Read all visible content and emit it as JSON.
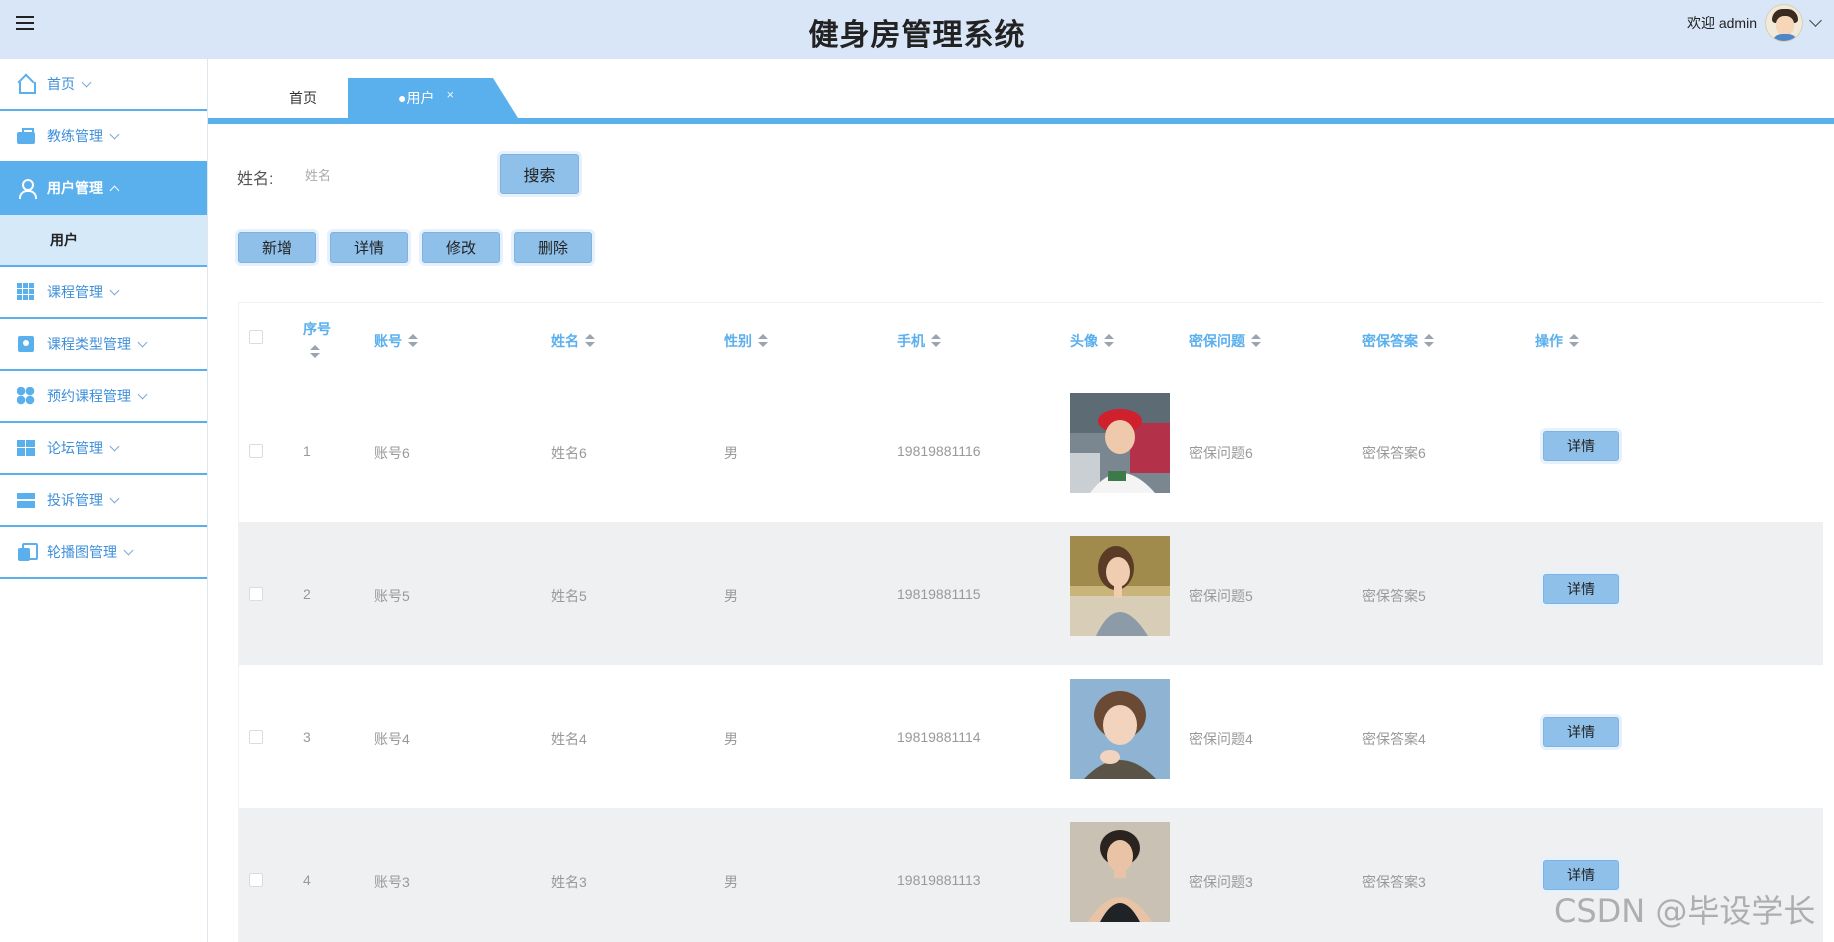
{
  "header": {
    "title": "健身房管理系统",
    "welcome": "欢迎 admin"
  },
  "sidebar": {
    "items": [
      {
        "label": "首页",
        "icon": "home-icon"
      },
      {
        "label": "教练管理",
        "icon": "briefcase-icon"
      },
      {
        "label": "用户管理",
        "icon": "user-icon",
        "active": true
      },
      {
        "label": "课程管理",
        "icon": "grid-icon"
      },
      {
        "label": "课程类型管理",
        "icon": "card-icon"
      },
      {
        "label": "预约课程管理",
        "icon": "clover-icon"
      },
      {
        "label": "论坛管理",
        "icon": "windows-icon"
      },
      {
        "label": "投诉管理",
        "icon": "tray-icon"
      },
      {
        "label": "轮播图管理",
        "icon": "copy-icon"
      }
    ],
    "submenu": {
      "label": "用户"
    }
  },
  "tabs": {
    "home": "首页",
    "user": "●用户",
    "close": "×"
  },
  "search": {
    "label": "姓名:",
    "placeholder": "姓名",
    "value": "",
    "button": "搜索"
  },
  "actions": {
    "add": "新增",
    "detail": "详情",
    "edit": "修改",
    "delete": "删除"
  },
  "table": {
    "headers": {
      "seq": "序号",
      "account": "账号",
      "name": "姓名",
      "gender": "性别",
      "phone": "手机",
      "avatar": "头像",
      "question": "密保问题",
      "answer": "密保答案",
      "op": "操作"
    },
    "rows": [
      {
        "seq": "1",
        "account": "账号6",
        "name": "姓名6",
        "gender": "男",
        "phone": "19819881116",
        "question": "密保问题6",
        "answer": "密保答案6",
        "op": "详情"
      },
      {
        "seq": "2",
        "account": "账号5",
        "name": "姓名5",
        "gender": "男",
        "phone": "19819881115",
        "question": "密保问题5",
        "answer": "密保答案5",
        "op": "详情"
      },
      {
        "seq": "3",
        "account": "账号4",
        "name": "姓名4",
        "gender": "男",
        "phone": "19819881114",
        "question": "密保问题4",
        "answer": "密保答案4",
        "op": "详情"
      },
      {
        "seq": "4",
        "account": "账号3",
        "name": "姓名3",
        "gender": "男",
        "phone": "19819881113",
        "question": "密保问题3",
        "answer": "密保答案3",
        "op": "详情"
      }
    ]
  },
  "watermark": "CSDN @毕设学长",
  "colors": {
    "accent": "#5aafed",
    "header_bg": "#d9e6f7",
    "button_bg": "#8fc0ea",
    "row_alt": "#eef0f2"
  }
}
